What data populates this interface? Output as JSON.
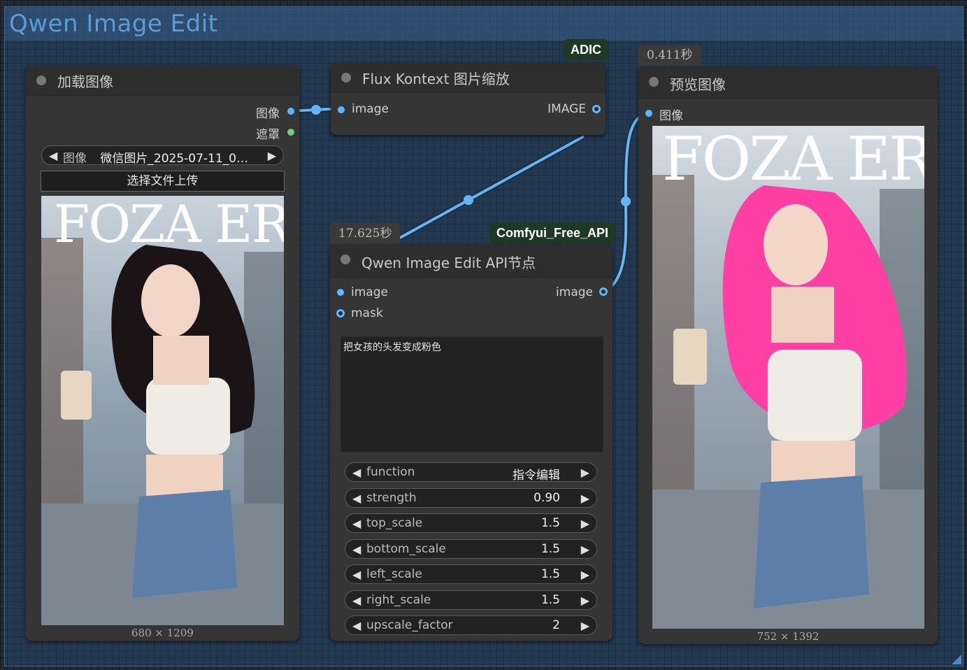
{
  "group": {
    "title": "Qwen Image Edit"
  },
  "load_node": {
    "title": "加载图像",
    "outputs": [
      "图像",
      "遮罩"
    ],
    "image_widget": {
      "name": "图像",
      "value": "微信图片_2025-07-11_0…"
    },
    "upload_label": "选择文件上传",
    "image_size": "680 × 1209",
    "photo_text": "FOZA ER"
  },
  "resize_node": {
    "title": "Flux Kontext 图片缩放",
    "badge": "ADIC",
    "input": "image",
    "output": "IMAGE"
  },
  "qwen_node": {
    "title": "Qwen Image Edit API节点",
    "badge": "Comfyui_Free_API",
    "time": "17.625秒",
    "inputs": [
      "image",
      "mask"
    ],
    "output": "image",
    "prompt": "把女孩的头发变成粉色",
    "widgets": [
      {
        "name": "function",
        "value": "指令编辑"
      },
      {
        "name": "strength",
        "value": "0.90"
      },
      {
        "name": "top_scale",
        "value": "1.5"
      },
      {
        "name": "bottom_scale",
        "value": "1.5"
      },
      {
        "name": "left_scale",
        "value": "1.5"
      },
      {
        "name": "right_scale",
        "value": "1.5"
      },
      {
        "name": "upscale_factor",
        "value": "2"
      }
    ]
  },
  "preview_node": {
    "title": "预览图像",
    "time": "0.411秒",
    "input": "图像",
    "image_size": "752 × 1392",
    "photo_text": "FOZA ER"
  },
  "colors": {
    "wire": "#64b5f6",
    "hair_original": "#1a1416",
    "hair_edited": "#ff3fa4",
    "badge_bg": "#1e3a24"
  }
}
